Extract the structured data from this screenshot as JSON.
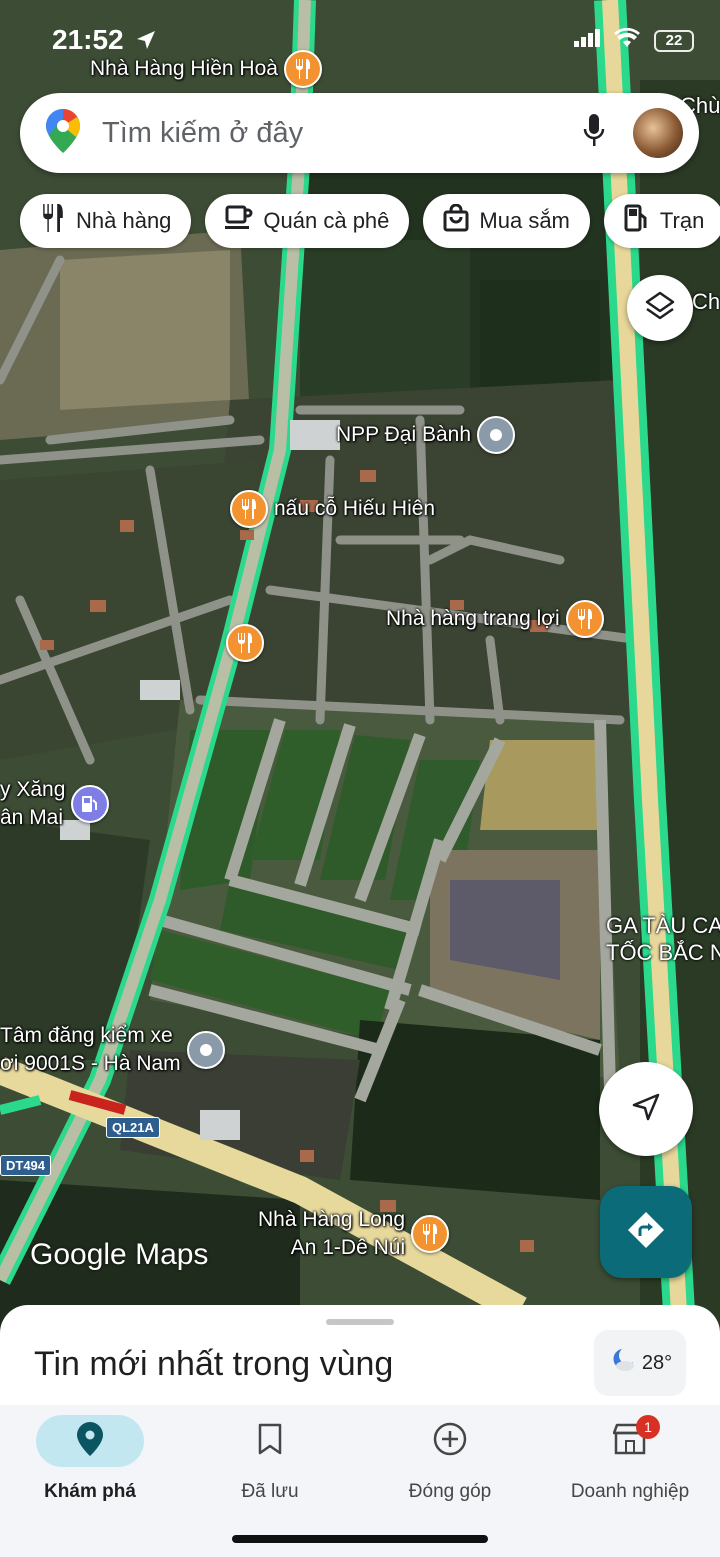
{
  "status_bar": {
    "time": "21:52",
    "battery": "22"
  },
  "search": {
    "placeholder": "Tìm kiếm ở đây"
  },
  "chips": [
    {
      "label": "Nhà hàng",
      "icon": "fork-knife-icon"
    },
    {
      "label": "Quán cà phê",
      "icon": "coffee-cup-icon"
    },
    {
      "label": "Mua sắm",
      "icon": "shopping-bag-icon"
    },
    {
      "label": "Trạn",
      "icon": "gas-station-icon"
    }
  ],
  "map": {
    "pois": [
      {
        "label": "Nhà Hàng Hiền Hoà",
        "type": "restaurant"
      },
      {
        "label": "NPP Đại Bành",
        "type": "place"
      },
      {
        "label": "nấu cỗ Hiếu Hiên",
        "type": "restaurant"
      },
      {
        "label": "Nhà hàng trang lợi",
        "type": "restaurant"
      },
      {
        "label": "",
        "type": "restaurant"
      },
      {
        "label": "Tâm đăng kiểm xe\nơi 9001S - Hà Nam",
        "type": "place"
      },
      {
        "label": "Nhà Hàng Long\nAn 1-Dê Núi",
        "type": "restaurant"
      },
      {
        "label": "y Xăng\nân Mai",
        "type": "gas"
      }
    ],
    "area_labels": {
      "station": "GA TÀU CA\nTỐC BẮC NA",
      "chu_top": "Chù",
      "chu_mid": "Ch"
    },
    "road_shields": {
      "ql21a": "QL21A",
      "dt494": "DT494"
    },
    "logo": "Google Maps"
  },
  "sheet": {
    "title": "Tin mới nhất trong vùng",
    "temperature": "28°"
  },
  "nav": [
    {
      "label": "Khám phá",
      "icon": "explore-pin-icon",
      "active": true
    },
    {
      "label": "Đã lưu",
      "icon": "bookmark-icon",
      "active": false
    },
    {
      "label": "Đóng góp",
      "icon": "add-circle-icon",
      "active": false
    },
    {
      "label": "Doanh nghiệp",
      "icon": "business-icon",
      "active": false,
      "badge": "1"
    }
  ],
  "colors": {
    "accent": "#0b6b78",
    "restaurant_pin": "#f29230",
    "road_highlight": "#2bd98c"
  }
}
